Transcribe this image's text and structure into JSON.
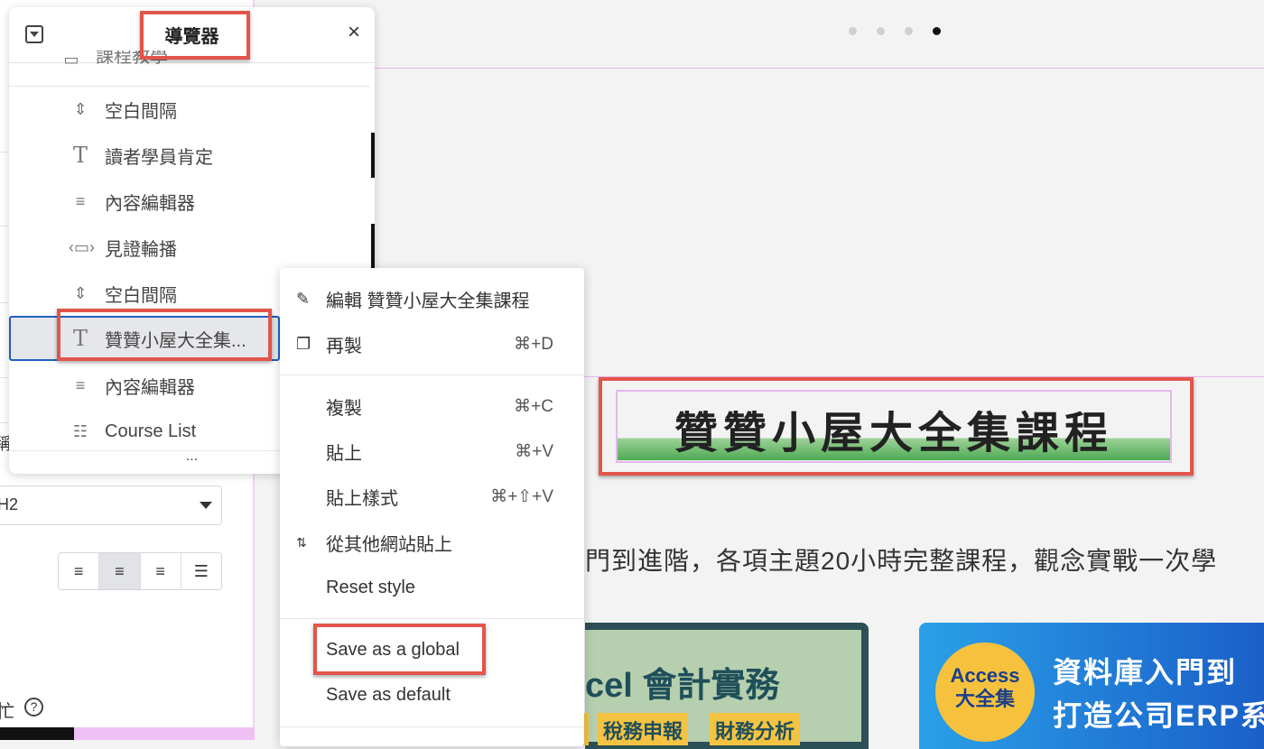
{
  "navigator": {
    "title": "導覽器",
    "close_icon": "×",
    "partial_item": "課程教學",
    "items": [
      {
        "label": "空白間隔",
        "icon": "spacer-icon"
      },
      {
        "label": "讀者學員肯定",
        "icon": "heading-icon"
      },
      {
        "label": "內容編輯器",
        "icon": "text-editor-icon"
      },
      {
        "label": "見證輪播",
        "icon": "testimonial-carousel-icon"
      },
      {
        "label": "空白間隔",
        "icon": "spacer-icon"
      },
      {
        "label": "贊贊小屋大全集...",
        "icon": "heading-icon",
        "selected": true
      },
      {
        "label": "內容編輯器",
        "icon": "text-editor-icon"
      },
      {
        "label": "Course List",
        "icon": "list-icon"
      }
    ],
    "footer": "..."
  },
  "context_menu": {
    "items": [
      {
        "label": "編輯 贊贊小屋大全集課程",
        "icon": "pencil-icon",
        "shortcut": ""
      },
      {
        "label": "再製",
        "icon": "duplicate-icon",
        "shortcut": "⌘+D"
      },
      {
        "label": "複製",
        "shortcut": "⌘+C"
      },
      {
        "label": "貼上",
        "shortcut": "⌘+V"
      },
      {
        "label": "貼上樣式",
        "shortcut": "⌘+⇧+V"
      },
      {
        "label": "從其他網站貼上",
        "icon": "arrows-updown-icon",
        "shortcut": ""
      },
      {
        "label": "Reset style",
        "shortcut": ""
      },
      {
        "label": "Save as a global",
        "shortcut": ""
      },
      {
        "label": "Save as default",
        "shortcut": ""
      }
    ]
  },
  "left_panel": {
    "clipped_label_1": "稱",
    "html_tag_select": "H2",
    "alignment": [
      "left",
      "center",
      "right",
      "justify"
    ],
    "alignment_active": "center",
    "clipped_label_2": "忙",
    "help_icon": "?"
  },
  "canvas": {
    "carousel_dots": 4,
    "carousel_active": 4,
    "heading": "贊贊小屋大全集課程",
    "paragraph": "門到進階，各項主題20小時完整課程，觀念實戰一次學",
    "card1": {
      "title": "cel 會計實務",
      "tags": [
        "稅務申報",
        "財務分析"
      ]
    },
    "card2": {
      "badge_line1": "Access",
      "badge_line2": "大全集",
      "line1": "資料庫入門到",
      "line2": "打造公司ERP系"
    }
  },
  "colors": {
    "highlight": "#e2554b",
    "selection": "#1f5fbf",
    "guide": "#e9b8ee"
  }
}
